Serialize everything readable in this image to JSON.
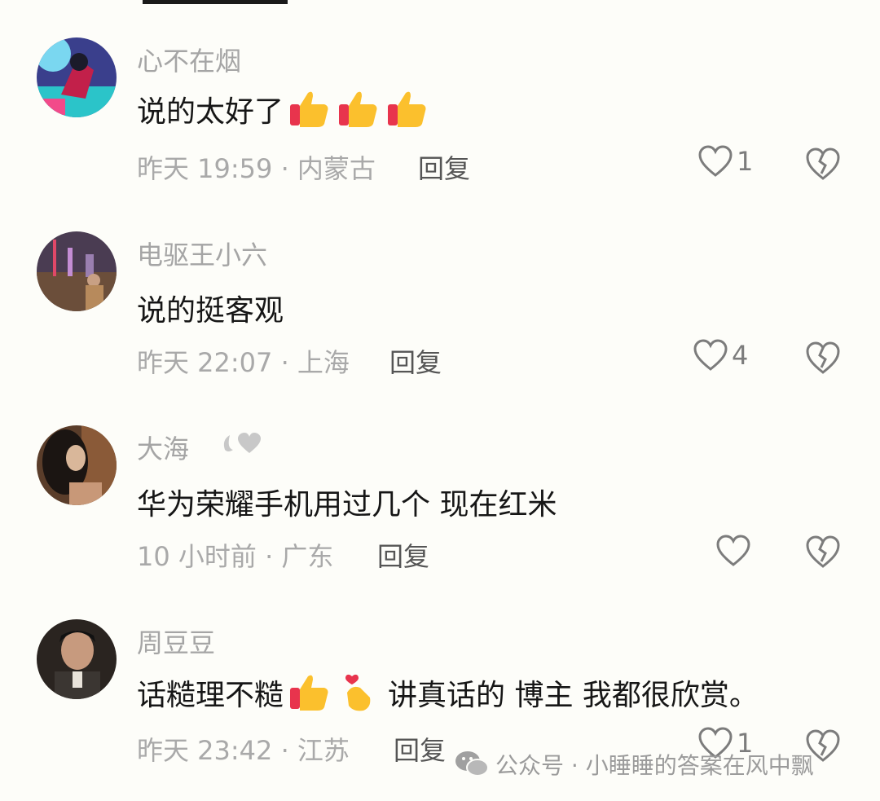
{
  "comments": [
    {
      "username": "心不在烟",
      "text": "说的太好了",
      "emojis": [
        "thumbs-up",
        "thumbs-up",
        "thumbs-up"
      ],
      "meta": "昨天 19:59 · 内蒙古",
      "reply_label": "回复",
      "like_count": "1"
    },
    {
      "username": "电驱王小六",
      "text": "说的挺客观",
      "meta": "昨天 22:07 · 上海",
      "reply_label": "回复",
      "like_count": "4"
    },
    {
      "username": "大海",
      "text": "华为荣耀手机用过几个 现在红米",
      "meta": "10 小时前 · 广东",
      "reply_label": "回复",
      "like_count": ""
    },
    {
      "username": "周豆豆",
      "text_before": "话糙理不糙",
      "text_after": "讲真话的 博主 我都很欣赏。",
      "emojis": [
        "thumbs-up",
        "finger-heart"
      ],
      "meta": "昨天 23:42 · 江苏",
      "reply_label": "回复",
      "like_count": "1"
    }
  ],
  "watermark": "公众号 · 小睡睡的答案在风中飘",
  "colors": {
    "background": "#fdfdf9",
    "username": "#a5a5a5",
    "text": "#161616",
    "meta": "#a9a9a9",
    "icon": "#7c7c7c"
  },
  "icons": {
    "like": "heart-outline-icon",
    "dislike": "broken-heart-icon",
    "watermark": "wechat-icon"
  }
}
